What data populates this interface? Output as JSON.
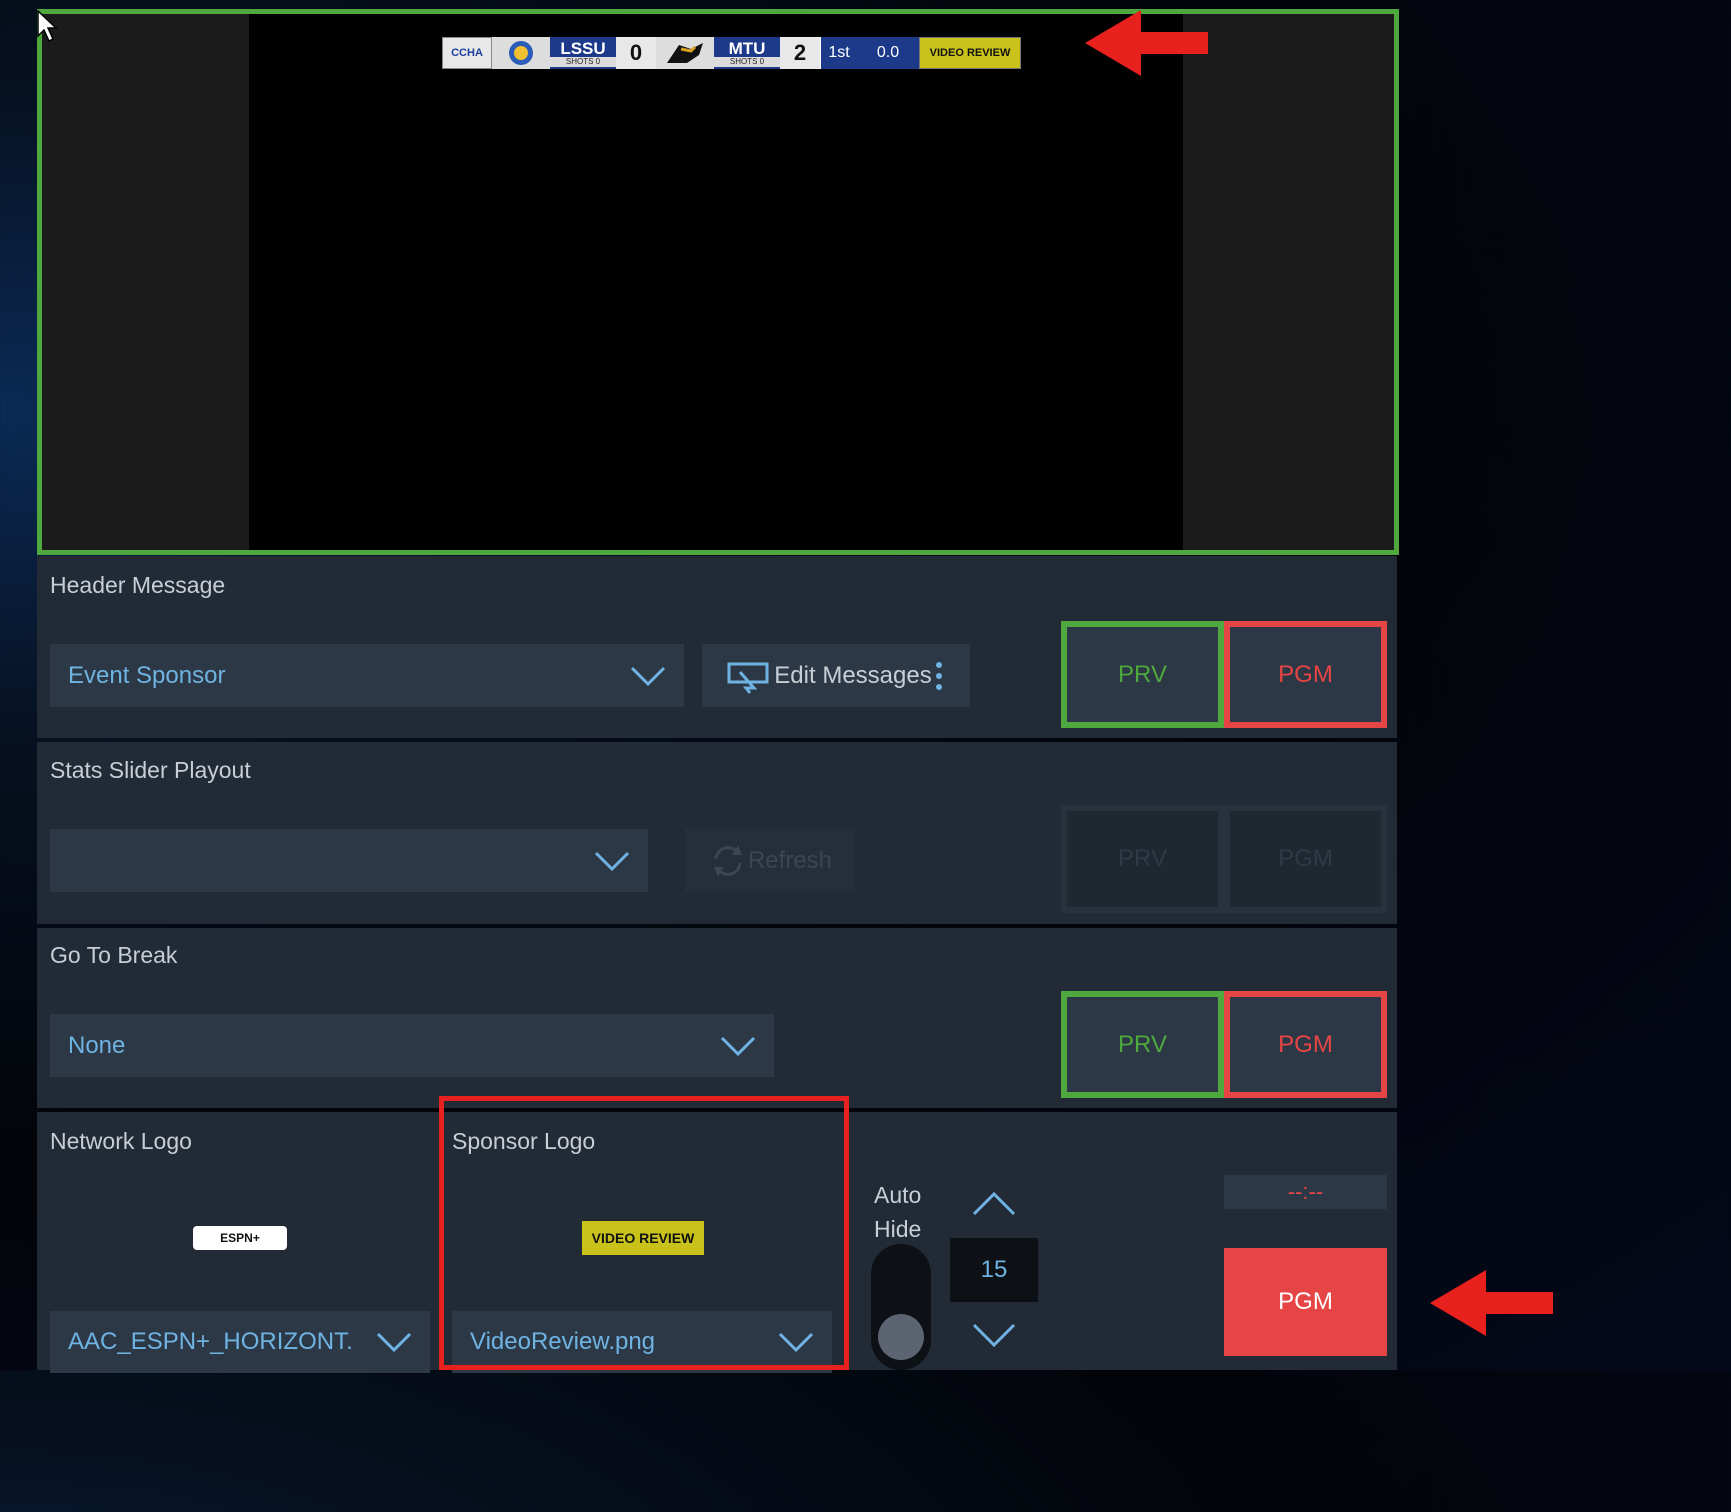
{
  "scorebug": {
    "league": "CCHA",
    "home_team": "LSSU",
    "home_shots_label": "SHOTS",
    "home_shots": "0",
    "home_score": "0",
    "away_team": "MTU",
    "away_shots_label": "SHOTS",
    "away_shots": "0",
    "away_score": "2",
    "period": "1st",
    "clock": "0.0",
    "banner": "VIDEO REVIEW"
  },
  "header_message": {
    "label": "Header Message",
    "selected": "Event Sponsor",
    "edit_label": "Edit Messages",
    "prv": "PRV",
    "pgm": "PGM"
  },
  "stats_slider": {
    "label": "Stats Slider Playout",
    "selected": "",
    "refresh_label": "Refresh",
    "prv": "PRV",
    "pgm": "PGM"
  },
  "go_to_break": {
    "label": "Go To Break",
    "selected": "None",
    "prv": "PRV",
    "pgm": "PGM"
  },
  "network_logo": {
    "label": "Network Logo",
    "logo_text": "ESPN+",
    "selected": "AAC_ESPN+_HORIZONT."
  },
  "sponsor_logo": {
    "label": "Sponsor Logo",
    "logo_text": "VIDEO REVIEW",
    "selected": "VideoReview.png"
  },
  "auto_hide": {
    "label_line1": "Auto",
    "label_line2": "Hide",
    "value": "15"
  },
  "timer": {
    "display": "--:--",
    "pgm": "PGM"
  },
  "colors": {
    "prv": "#4fa83d",
    "pgm": "#e64545",
    "annotation": "#e8201e"
  }
}
